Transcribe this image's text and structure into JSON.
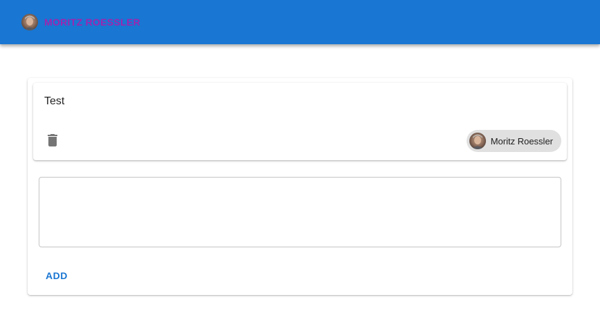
{
  "appbar": {
    "user_name": "Moritz Roessler",
    "background_color": "#1976d2",
    "user_name_color": "#9c27b0"
  },
  "note": {
    "text": "Test",
    "delete_icon": "trash-icon",
    "author_chip": {
      "label": "Moritz Roessler"
    }
  },
  "new_note": {
    "value": "",
    "placeholder": ""
  },
  "actions": {
    "add_label": "ADD",
    "add_color": "#1976d2"
  }
}
